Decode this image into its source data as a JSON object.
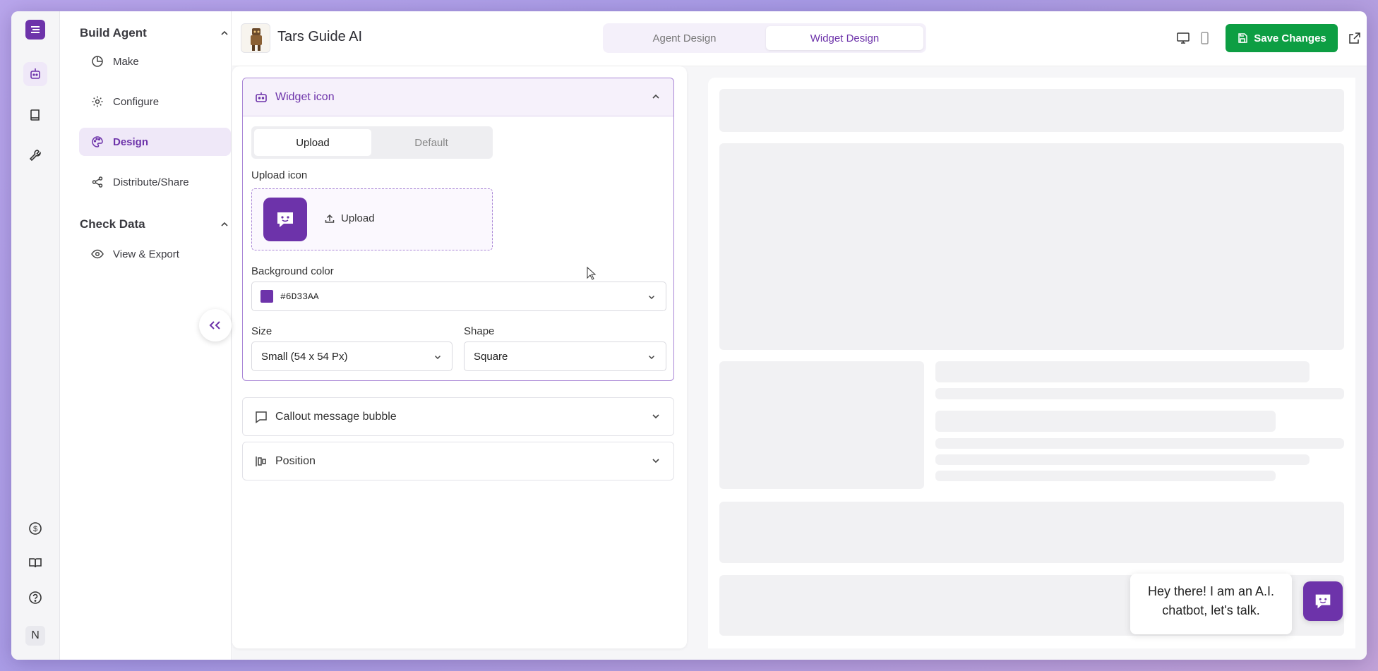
{
  "theme": {
    "accent": "#6D33AA",
    "save_green": "#0D9E43"
  },
  "rail": {
    "items": [
      "robot-icon",
      "book-icon",
      "wrench-icon"
    ],
    "bottom": [
      "billing-icon",
      "docs-icon",
      "help-icon"
    ],
    "avatar_initial": "N"
  },
  "nav": {
    "sections": [
      {
        "title": "Build Agent",
        "items": [
          "Make",
          "Configure",
          "Design",
          "Distribute/Share"
        ]
      },
      {
        "title": "Check Data",
        "items": [
          "View & Export"
        ]
      }
    ],
    "active": "Design"
  },
  "header": {
    "agent_name": "Tars Guide AI",
    "tabs": [
      "Agent Design",
      "Widget Design"
    ],
    "active_tab": "Widget Design",
    "save_label": "Save Changes"
  },
  "widget_icon": {
    "title": "Widget icon",
    "tabs": [
      "Upload",
      "Default"
    ],
    "active_tab": "Upload",
    "upload_label": "Upload icon",
    "upload_button": "Upload",
    "bg_label": "Background color",
    "bg_value": "#6D33AA",
    "size_label": "Size",
    "size_value": "Small (54 x 54 Px)",
    "shape_label": "Shape",
    "shape_value": "Square"
  },
  "callout": {
    "title": "Callout message bubble"
  },
  "position": {
    "title": "Position"
  },
  "preview": {
    "bubble_line1": "Hey there! I am an A.I.",
    "bubble_line2": "chatbot, let's talk."
  }
}
